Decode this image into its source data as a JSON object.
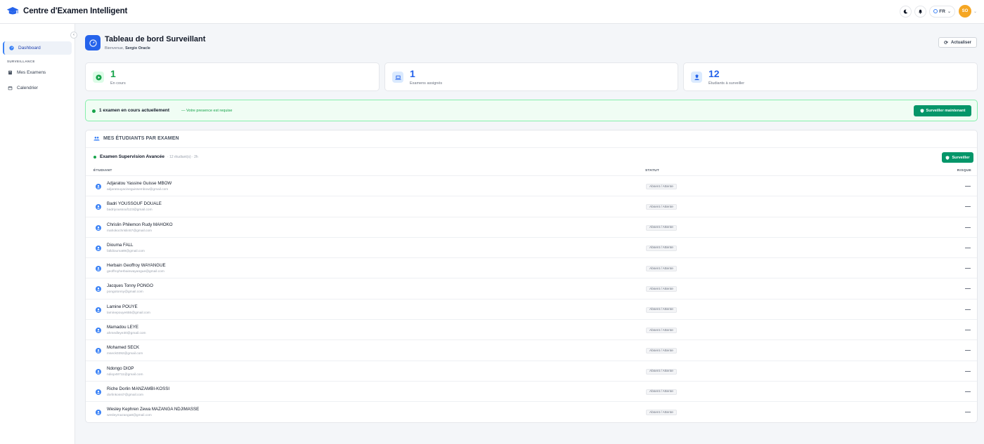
{
  "app": {
    "title": "Centre d'Examen Intelligent"
  },
  "topbar": {
    "language": "FR",
    "avatar_initials": "SO"
  },
  "sidebar": {
    "section_label": "SURVEILLANCE",
    "items": [
      {
        "label": "Dashboard",
        "icon": "dashboard-icon",
        "active": true
      },
      {
        "label": "Mes Examens",
        "icon": "book-icon",
        "active": false
      },
      {
        "label": "Calendrier",
        "icon": "calendar-icon",
        "active": false
      }
    ]
  },
  "header": {
    "title": "Tableau de bord Surveillant",
    "welcome_prefix": "Bienvenue,",
    "user_name": "Sergio Oracle",
    "refresh_label": "Actualiser"
  },
  "stats": [
    {
      "value": "1",
      "label": "En cours",
      "color": "#16a34a",
      "icon": "play-icon"
    },
    {
      "value": "1",
      "label": "Examens assignés",
      "color": "#2563eb",
      "icon": "laptop-icon"
    },
    {
      "value": "12",
      "label": "Étudiants à surveiller",
      "color": "#2563eb",
      "icon": "student-icon"
    }
  ],
  "alert": {
    "title": "1 examen en cours actuellement",
    "subtitle": "— Votre presence est requise",
    "button_label": "Surveiller maintenant"
  },
  "panel": {
    "title": "MES ÉTUDIANTS PAR EXAMEN",
    "exam_name": "Examen Supervision Avancée",
    "exam_meta": "· 12 étudiant(s) · 2h",
    "surveiller_label": "Surveiller",
    "columns": {
      "student": "ÉTUDIANT",
      "status": "STATUT",
      "risk": "RISQUE"
    },
    "students": [
      {
        "name": "Adjaratou Yassine Guisse MBOW",
        "email": "adjaratouyacineguissembow@gmail.com",
        "status": "Absent / Attente",
        "risk": "—"
      },
      {
        "name": "Badri YOUSSOUF DOUALE",
        "email": "badriyoussouf123@gmail.com",
        "status": "Absent / Attente",
        "risk": "—"
      },
      {
        "name": "Chrislin Philemon Rudy MAHOKO",
        "email": "mahokochrislin57@gmail.com",
        "status": "Absent / Attente",
        "risk": "—"
      },
      {
        "name": "Diouma FALL",
        "email": "falldiouma89@gmail.com",
        "status": "Absent / Attente",
        "risk": "—"
      },
      {
        "name": "Herbain Geoffroy WAYANGUE",
        "email": "geoffroyherbainwayangue@gmail.com",
        "status": "Absent / Attente",
        "risk": "—"
      },
      {
        "name": "Jacques Tonny PONGO",
        "email": "pongotonny@gmail.com",
        "status": "Absent / Attente",
        "risk": "—"
      },
      {
        "name": "Lamine POUYE",
        "email": "laminepouye655@gmail.com",
        "status": "Absent / Attente",
        "risk": "—"
      },
      {
        "name": "Mamadou LEYE",
        "email": "ahmedleye30@gmail.com",
        "status": "Absent / Attente",
        "risk": "—"
      },
      {
        "name": "Mohamed SECK",
        "email": "mseck0392@gmail.com",
        "status": "Absent / Attente",
        "risk": "—"
      },
      {
        "name": "Ndongo DIOP",
        "email": "ndiop48711@gmail.com",
        "status": "Absent / Attente",
        "risk": "—"
      },
      {
        "name": "Riche Dorlin MANZAMBI-KOSSI",
        "email": "dorlinkossi7@gmail.com",
        "status": "Absent / Attente",
        "risk": "—"
      },
      {
        "name": "Wesley Kephren Zewa MAZANGA NDJIMASSE",
        "email": "wesleymazanga8@gmail.com",
        "status": "Absent / Attente",
        "risk": "—"
      }
    ]
  }
}
